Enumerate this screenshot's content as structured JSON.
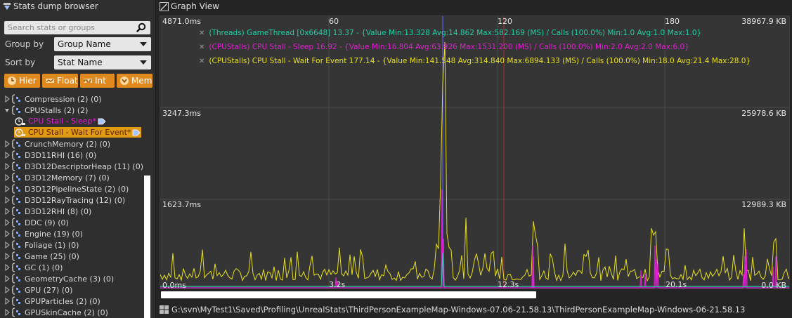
{
  "left_panel": {
    "title": "Stats dump browser",
    "search_placeholder": "Search stats or groups",
    "group_by_label": "Group by",
    "group_by_value": "Group Name",
    "sort_by_label": "Sort by",
    "sort_by_value": "Stat Name",
    "toggles": [
      {
        "label": "Hier",
        "icon": "hierarchy-icon"
      },
      {
        "label": "Float",
        "icon": "float-icon"
      },
      {
        "label": "Int",
        "icon": "int-icon"
      },
      {
        "label": "Mem",
        "icon": "memory-icon"
      }
    ],
    "tree": [
      {
        "label": "Compression (2) (0)",
        "expanded": false
      },
      {
        "label": "CPUStalls (2) (2)",
        "expanded": true
      },
      {
        "label": "CPU Stall - Sleep*",
        "child": true,
        "color": "#e020d0"
      },
      {
        "label": "CPU Stall - Wait For Event*",
        "child": true,
        "selected": true
      },
      {
        "label": "CrunchMemory (2) (0)",
        "expanded": false
      },
      {
        "label": "D3D11RHI (16) (0)",
        "expanded": false
      },
      {
        "label": "D3D12DescriptorHeap (11) (0)",
        "expanded": false
      },
      {
        "label": "D3D12Memory (7) (0)",
        "expanded": false
      },
      {
        "label": "D3D12PipelineState (2) (0)",
        "expanded": false
      },
      {
        "label": "D3D12RayTracing (12) (0)",
        "expanded": false
      },
      {
        "label": "D3D12RHI (8) (0)",
        "expanded": false
      },
      {
        "label": "DDC (9) (0)",
        "expanded": false
      },
      {
        "label": "Engine (19) (0)",
        "expanded": false
      },
      {
        "label": "Foliage (1) (0)",
        "expanded": false
      },
      {
        "label": "Game (25) (0)",
        "expanded": false
      },
      {
        "label": "GC (1) (0)",
        "expanded": false
      },
      {
        "label": "GeometryCache (3) (0)",
        "expanded": false
      },
      {
        "label": "GPU (27) (0)",
        "expanded": false
      },
      {
        "label": "GPUParticles (2) (0)",
        "expanded": false
      },
      {
        "label": "GPUSkinCache (2) (0)",
        "expanded": false
      }
    ]
  },
  "graph_view": {
    "title": "Graph View",
    "top_ticks": [
      "60",
      "120",
      "180"
    ],
    "bottom_ticks": [
      "3.2s",
      "12.3s",
      "20.1s"
    ],
    "left_axis": [
      "4871.0ms",
      "3247.3ms",
      "1623.7ms",
      "0.0ms"
    ],
    "right_axis": [
      "38967.9 KB",
      "25978.6 KB",
      "12989.3 KB",
      "0.0 KB"
    ],
    "legend": [
      {
        "text": "(Threads) GameThread [0x6648] 13.37 - {Value Min:13.328 Avg:14.862 Max:582.169 (MS) / Calls (100.0%) Min:1.0 Avg:1.0 Max:1.0}",
        "color": "#1fd0a8"
      },
      {
        "text": "(CPUStalls) CPU Stall - Sleep 16.92 - {Value Min:16.804 Avg:63.926 Max:1531.200 (MS) / Calls (100.0%) Min:2.0 Avg:2.0 Max:6.0}",
        "color": "#e020d0"
      },
      {
        "text": "(CPUStalls) CPU Stall - Wait For Event 177.14 - {Value Min:141.548 Avg:314.840 Max:6894.133 (MS) / Calls (100.0%) Min:18.0 Avg:21.4 Max:28.0}",
        "color": "#e8e020"
      }
    ],
    "path": "G:\\svn\\MyTest1\\Saved\\Profiling\\UnrealStats\\ThirdPersonExampleMap-Windows-07.06-21.58.13\\ThirdPersonExampleMap-Windows-06-21.58.13"
  },
  "colors": {
    "accent": "#e08a1e",
    "selection": "#e19a14",
    "yellow_series": "#e8e020",
    "magenta_series": "#e020d0",
    "teal_series": "#1fd0a8"
  }
}
